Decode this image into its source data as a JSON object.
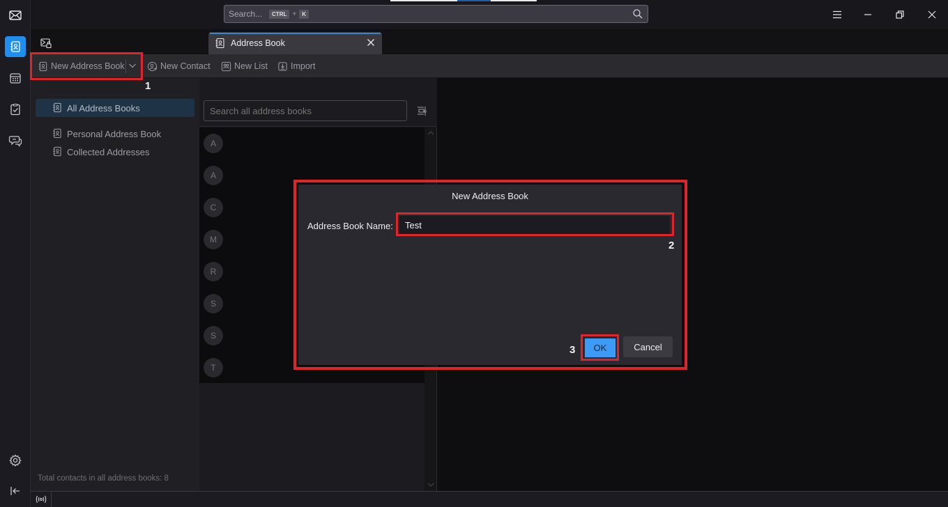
{
  "titlebar": {
    "search_placeholder": "Search...",
    "shortcut_key1": "CTRL",
    "shortcut_plus": "+",
    "shortcut_key2": "K",
    "icons": [
      "search-icon",
      "menu-icon",
      "minimize-icon",
      "restore-icon",
      "close-icon"
    ]
  },
  "spaces": {
    "items": [
      {
        "name": "mail",
        "icon": "mail-icon"
      },
      {
        "name": "address-book",
        "icon": "address-book-icon",
        "active": true
      },
      {
        "name": "calendar",
        "icon": "calendar-icon"
      },
      {
        "name": "tasks",
        "icon": "tasks-icon"
      },
      {
        "name": "chat",
        "icon": "chat-icon"
      }
    ],
    "bottom": [
      {
        "name": "settings",
        "icon": "gear-icon"
      },
      {
        "name": "collapse",
        "icon": "collapse-icon"
      }
    ]
  },
  "tabs": [
    {
      "label": "Address Book",
      "active": true,
      "icon": "address-book-icon"
    }
  ],
  "toolbar": {
    "new_address_book": "New Address Book",
    "new_contact": "New Contact",
    "new_list": "New List",
    "import": "Import"
  },
  "books": {
    "items": [
      {
        "label": "All Address Books",
        "selected": true
      },
      {
        "label": "Personal Address Book",
        "selected": false
      },
      {
        "label": "Collected Addresses",
        "selected": false
      }
    ],
    "total": "Total contacts in all address books: 8"
  },
  "contacts": {
    "search_placeholder": "Search all address books",
    "avatars": [
      "A",
      "A",
      "C",
      "M",
      "R",
      "S",
      "S",
      "T"
    ]
  },
  "dialog": {
    "title": "New Address Book",
    "name_label": "Address Book Name:",
    "name_value": "Test",
    "ok": "OK",
    "cancel": "Cancel"
  },
  "annotations": {
    "step1": "1",
    "step2": "2",
    "step3": "3",
    "color": "#e0242c"
  },
  "colors": {
    "accent": "#1e8ef0",
    "ok_button": "#3d9af5",
    "selection": "#1f3346"
  }
}
